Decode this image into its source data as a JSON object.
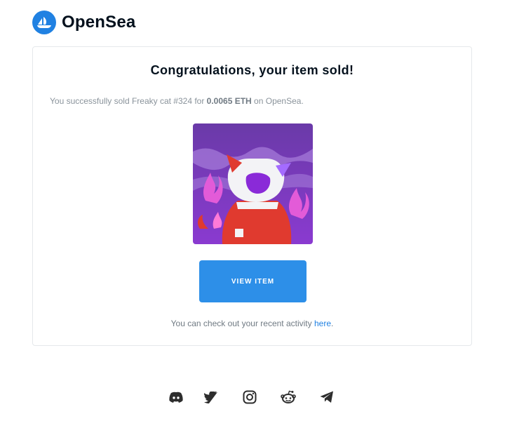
{
  "brand": {
    "name": "OpenSea",
    "accent_color": "#2081e2"
  },
  "card": {
    "title": "Congratulations, your item sold!",
    "message": {
      "prefix": "You successfully sold Freaky cat #324 for ",
      "amount": "0.0065 ETH",
      "suffix": " on OpenSea."
    },
    "image_alt": "Freaky cat #324",
    "button_label": "VIEW ITEM",
    "button_color": "#2d8fe8",
    "activity": {
      "prefix": "You can check out your recent activity ",
      "link_text": "here",
      "suffix": "."
    }
  },
  "footer": {
    "social_icons": [
      "discord-icon",
      "twitter-icon",
      "instagram-icon",
      "reddit-icon",
      "telegram-icon"
    ]
  }
}
